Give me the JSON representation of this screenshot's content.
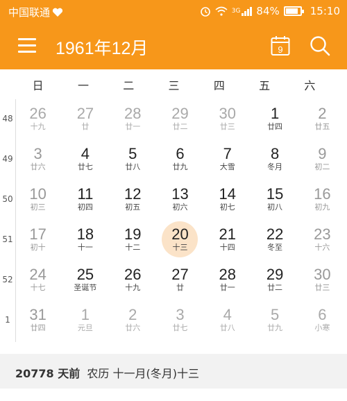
{
  "status": {
    "carrier": "中国联通",
    "network": "3G",
    "battery": "84%",
    "battery_level": 0.84,
    "time": "15:10"
  },
  "toolbar": {
    "title": "1961年12月",
    "calendar_day": "9"
  },
  "weekdays": [
    "日",
    "一",
    "二",
    "三",
    "四",
    "五",
    "六"
  ],
  "week_numbers": [
    "48",
    "49",
    "50",
    "51",
    "52",
    "1"
  ],
  "weeks": [
    [
      {
        "d": "26",
        "l": "十九",
        "o": true
      },
      {
        "d": "27",
        "l": "廿",
        "o": true
      },
      {
        "d": "28",
        "l": "廿一",
        "o": true
      },
      {
        "d": "29",
        "l": "廿二",
        "o": true
      },
      {
        "d": "30",
        "l": "廿三",
        "o": true
      },
      {
        "d": "1",
        "l": "廿四"
      },
      {
        "d": "2",
        "l": "廿五",
        "w": true
      }
    ],
    [
      {
        "d": "3",
        "l": "廿六",
        "w": true
      },
      {
        "d": "4",
        "l": "廿七"
      },
      {
        "d": "5",
        "l": "廿八"
      },
      {
        "d": "6",
        "l": "廿九"
      },
      {
        "d": "7",
        "l": "大雪"
      },
      {
        "d": "8",
        "l": "冬月"
      },
      {
        "d": "9",
        "l": "初二",
        "w": true
      }
    ],
    [
      {
        "d": "10",
        "l": "初三",
        "w": true
      },
      {
        "d": "11",
        "l": "初四"
      },
      {
        "d": "12",
        "l": "初五"
      },
      {
        "d": "13",
        "l": "初六"
      },
      {
        "d": "14",
        "l": "初七"
      },
      {
        "d": "15",
        "l": "初八"
      },
      {
        "d": "16",
        "l": "初九",
        "w": true
      }
    ],
    [
      {
        "d": "17",
        "l": "初十",
        "w": true
      },
      {
        "d": "18",
        "l": "十一"
      },
      {
        "d": "19",
        "l": "十二"
      },
      {
        "d": "20",
        "l": "十三",
        "t": true
      },
      {
        "d": "21",
        "l": "十四"
      },
      {
        "d": "22",
        "l": "冬至"
      },
      {
        "d": "23",
        "l": "十六",
        "w": true
      }
    ],
    [
      {
        "d": "24",
        "l": "十七",
        "w": true
      },
      {
        "d": "25",
        "l": "圣诞节"
      },
      {
        "d": "26",
        "l": "十九"
      },
      {
        "d": "27",
        "l": "廿"
      },
      {
        "d": "28",
        "l": "廿一"
      },
      {
        "d": "29",
        "l": "廿二"
      },
      {
        "d": "30",
        "l": "廿三",
        "w": true
      }
    ],
    [
      {
        "d": "31",
        "l": "廿四",
        "w": true
      },
      {
        "d": "1",
        "l": "元旦",
        "o": true
      },
      {
        "d": "2",
        "l": "廿六",
        "o": true
      },
      {
        "d": "3",
        "l": "廿七",
        "o": true
      },
      {
        "d": "4",
        "l": "廿八",
        "o": true
      },
      {
        "d": "5",
        "l": "廿九",
        "o": true
      },
      {
        "d": "6",
        "l": "小寒",
        "o": true
      }
    ]
  ],
  "footer": {
    "days_ago": "20778 天前",
    "lunar": "农历 十一月(冬月)十三"
  },
  "colors": {
    "accent": "#f7971a",
    "today_highlight": "#fbe3c8"
  }
}
